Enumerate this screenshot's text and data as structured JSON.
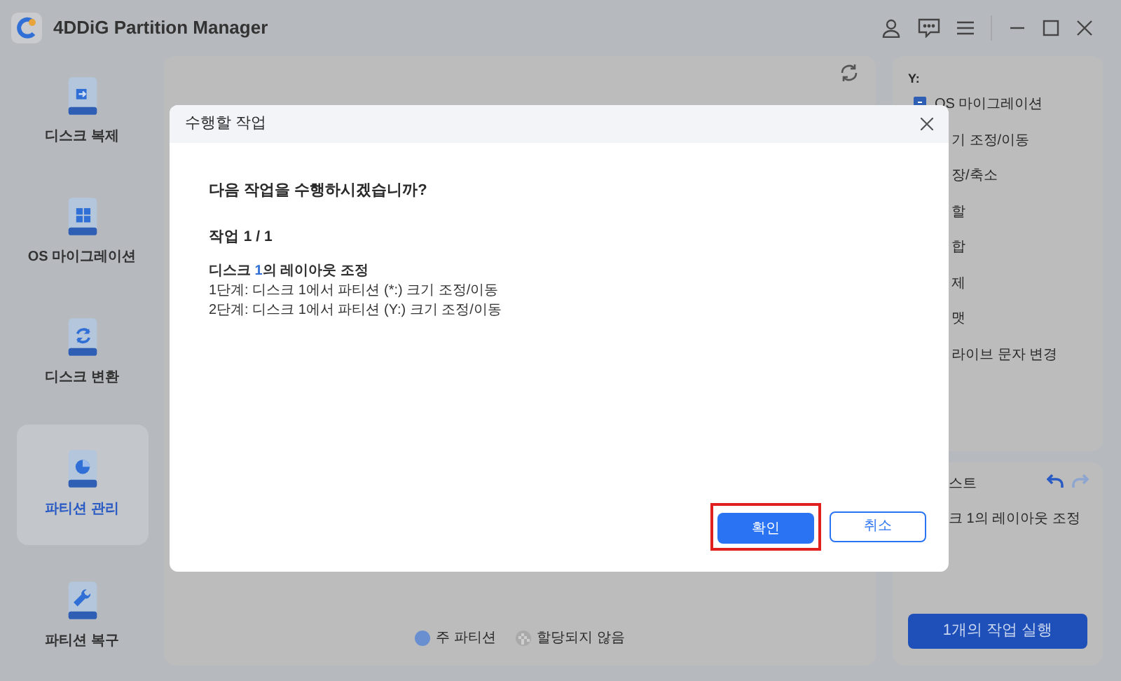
{
  "window": {
    "title": "4DDiG Partition Manager"
  },
  "sidebar": {
    "items": [
      {
        "label": "디스크 복제",
        "kind": "clone",
        "selected": false
      },
      {
        "label": "OS 마이그레이션",
        "kind": "windows",
        "selected": false
      },
      {
        "label": "디스크 변환",
        "kind": "convert",
        "selected": false
      },
      {
        "label": "파티션 관리",
        "kind": "pie",
        "selected": true
      },
      {
        "label": "파티션 복구",
        "kind": "wrench",
        "selected": false
      }
    ]
  },
  "legend": [
    {
      "label": "주 파티션",
      "kind": "primary"
    },
    {
      "label": "할당되지 않음",
      "kind": "unallocated"
    }
  ],
  "right_panel": {
    "drive": "Y:",
    "actions": [
      "OS 마이그레이션",
      "기 조정/이동",
      "장/축소",
      "할",
      "합",
      "제",
      "맷",
      "라이브 문자 변경"
    ]
  },
  "task_panel": {
    "title": "스트",
    "tasks": [
      "크 1의 레이아웃 조정"
    ],
    "run_button": "1개의 작업 실행"
  },
  "dialog": {
    "title": "수행할 작업",
    "question": "다음 작업을 수행하시겠습니까?",
    "task_heading": "작업 1 / 1",
    "layout_title": {
      "prefix": "디스크 ",
      "disk": "1",
      "suffix": "의 레이아웃 조정"
    },
    "lines": [
      "1단계: 디스크 1에서 파티션 (*:) 크기 조정/이동",
      "2단계: 디스크 1에서 파티션 (Y:) 크기 조정/이동"
    ],
    "ok_button": "확인",
    "cancel_button": "취소"
  }
}
